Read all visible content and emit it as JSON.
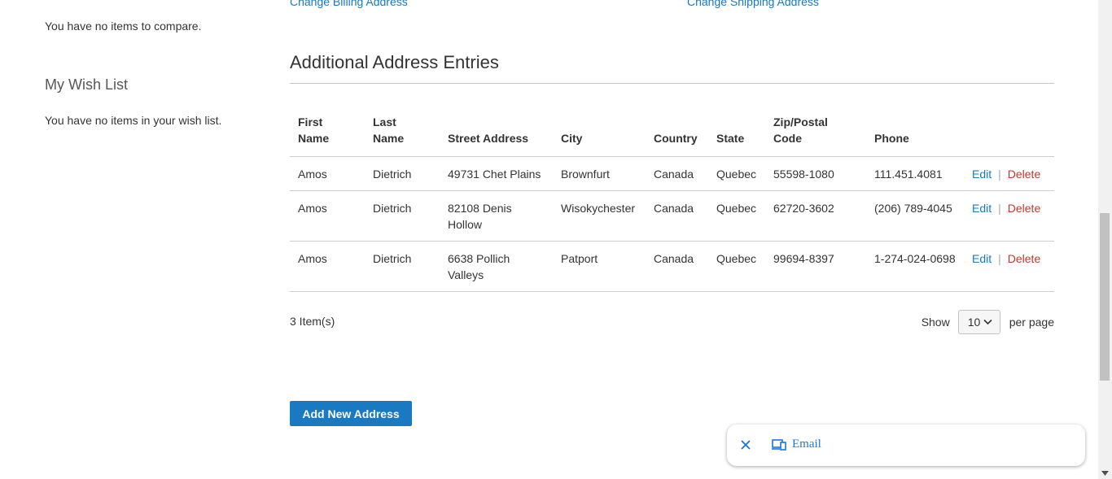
{
  "top_links": {
    "billing": "Change Billing Address",
    "shipping": "Change Shipping Address"
  },
  "sidebar": {
    "compare_empty": "You have no items to compare.",
    "wishlist_title": "My Wish List",
    "wishlist_empty": "You have no items in your wish list."
  },
  "addresses": {
    "title": "Additional Address Entries",
    "headers": {
      "first_name_1": "First",
      "first_name_2": "Name",
      "last_name_1": "Last",
      "last_name_2": "Name",
      "street": "Street Address",
      "city": "City",
      "country": "Country",
      "state": "State",
      "zip_1": "Zip/Postal",
      "zip_2": "Code",
      "phone": "Phone"
    },
    "rows": [
      {
        "first": "Amos",
        "last": "Dietrich",
        "street": "49731 Chet Plains",
        "city": "Brownfurt",
        "country": "Canada",
        "state": "Quebec",
        "zip": "55598-1080",
        "phone": "111.451.4081",
        "edit": "Edit",
        "delete": "Delete"
      },
      {
        "first": "Amos",
        "last": "Dietrich",
        "street": "82108 Denis Hollow",
        "city": "Wisokychester",
        "country": "Canada",
        "state": "Quebec",
        "zip": "62720-3602",
        "phone": "(206) 789-4045",
        "edit": "Edit",
        "delete": "Delete"
      },
      {
        "first": "Amos",
        "last": "Dietrich",
        "street": "6638 Pollich Valleys",
        "city": "Patport",
        "country": "Canada",
        "state": "Quebec",
        "zip": "99694-8397",
        "phone": "1-274-024-0698",
        "edit": "Edit",
        "delete": "Delete"
      }
    ],
    "separator": "|"
  },
  "pager": {
    "items_count": "3 Item(s)",
    "show_label": "Show",
    "limit_value": "10",
    "per_page_label": "per page"
  },
  "add_button_label": "Add New Address",
  "popup": {
    "label": "Email",
    "close_icon": "close-icon",
    "device_icon": "devices-icon"
  },
  "colors": {
    "link": "#1979c3",
    "primary_button": "#1979c3",
    "delete_link": "#c0392b",
    "popup_link": "#1a73e8"
  }
}
